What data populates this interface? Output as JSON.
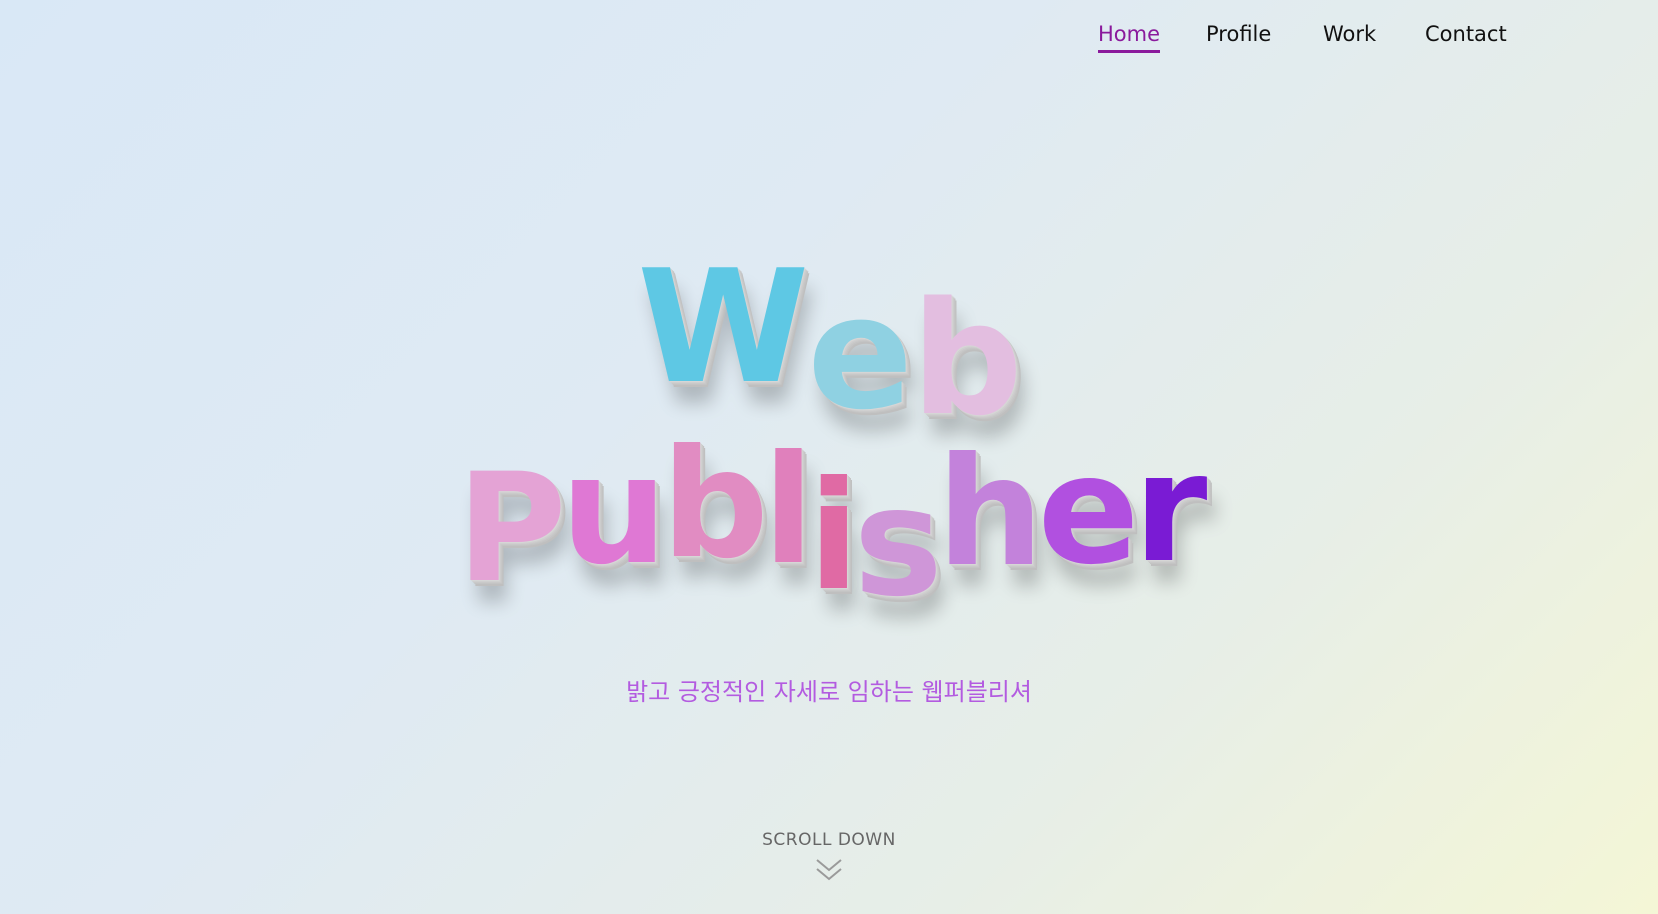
{
  "nav": {
    "items": [
      {
        "label": "Home",
        "active": true
      },
      {
        "label": "Profile",
        "active": false
      },
      {
        "label": "Work",
        "active": false
      },
      {
        "label": "Contact",
        "active": false
      }
    ],
    "active_color": "#8a1a9c"
  },
  "hero": {
    "line1": {
      "text": "Web",
      "letters": [
        {
          "ch": "W",
          "color": "#5ec8e4"
        },
        {
          "ch": "e",
          "color": "#8fd1e2"
        },
        {
          "ch": "b",
          "color": "#e3bee0"
        }
      ]
    },
    "line2": {
      "text": "Publisher",
      "letters": [
        {
          "ch": "P",
          "color": "#e4a3d5"
        },
        {
          "ch": "u",
          "color": "#df78d4"
        },
        {
          "ch": "b",
          "color": "#e18cc2"
        },
        {
          "ch": "l",
          "color": "#e080bc"
        },
        {
          "ch": "i",
          "color": "#e06aa4"
        },
        {
          "ch": "s",
          "color": "#cf96d8"
        },
        {
          "ch": "h",
          "color": "#c382db"
        },
        {
          "ch": "e",
          "color": "#b150e0"
        },
        {
          "ch": "r",
          "color": "#7a1bd4"
        }
      ]
    },
    "subtitle": "밝고 긍정적인 자세로 임하는 웹퍼블리셔",
    "subtitle_color": "#b35be0"
  },
  "scroll": {
    "label": "SCROLL DOWN",
    "icon": "double-chevron-down-icon"
  }
}
